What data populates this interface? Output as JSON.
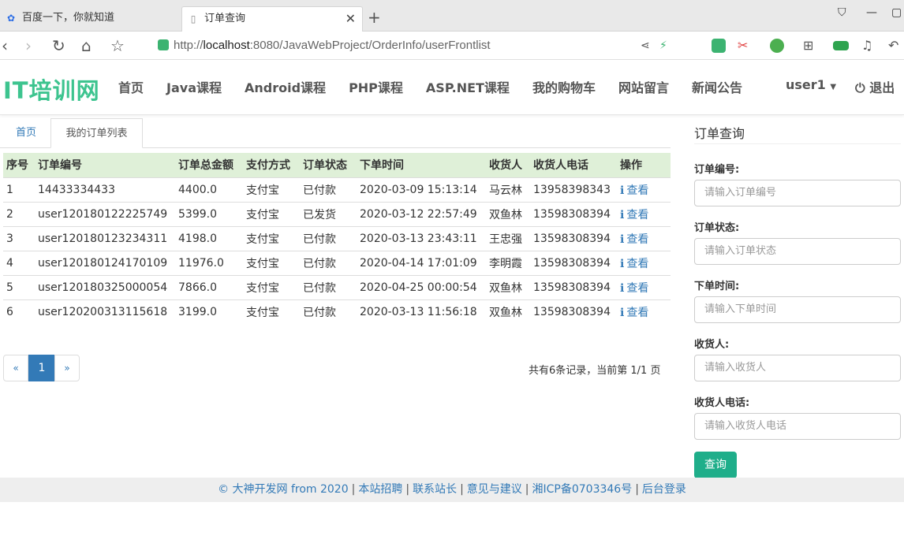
{
  "browser": {
    "tabs": [
      {
        "title": "百度一下，你就知道",
        "icon": "paw-icon"
      },
      {
        "title": "订单查询",
        "icon": "page-icon"
      }
    ],
    "url_prefix": "http://",
    "url_host": "localhost",
    "url_rest": ":8080/JavaWebProject/OrderInfo/userFrontlist"
  },
  "site": {
    "logo": "IT培训网",
    "nav": [
      "首页",
      "Java课程",
      "Android课程",
      "PHP课程",
      "ASP.NET课程",
      "我的购物车",
      "网站留言",
      "新闻公告"
    ],
    "user": "user1",
    "logout": "退出"
  },
  "page": {
    "tabs": [
      "首页",
      "我的订单列表"
    ],
    "table": {
      "headers": [
        "序号",
        "订单编号",
        "订单总金额",
        "支付方式",
        "订单状态",
        "下单时间",
        "收货人",
        "收货人电话",
        "操作"
      ],
      "rows": [
        [
          "1",
          "14433334433",
          "4400.0",
          "支付宝",
          "已付款",
          "2020-03-09 15:13:14",
          "马云林",
          "13958398343",
          "查看"
        ],
        [
          "2",
          "user120180122225749",
          "5399.0",
          "支付宝",
          "已发货",
          "2020-03-12 22:57:49",
          "双鱼林",
          "13598308394",
          "查看"
        ],
        [
          "3",
          "user120180123234311",
          "4198.0",
          "支付宝",
          "已付款",
          "2020-03-13 23:43:11",
          "王忠强",
          "13598308394",
          "查看"
        ],
        [
          "4",
          "user120180124170109",
          "11976.0",
          "支付宝",
          "已付款",
          "2020-04-14 17:01:09",
          "李明霞",
          "13598308394",
          "查看"
        ],
        [
          "5",
          "user120180325000054",
          "7866.0",
          "支付宝",
          "已付款",
          "2020-04-25 00:00:54",
          "双鱼林",
          "13598308394",
          "查看"
        ],
        [
          "6",
          "user120200313115618",
          "3199.0",
          "支付宝",
          "已付款",
          "2020-03-13 11:56:18",
          "双鱼林",
          "13598308394",
          "查看"
        ]
      ]
    },
    "pager": {
      "prev": "«",
      "current": "1",
      "next": "»"
    },
    "summary": "共有6条记录，当前第 1/1 页"
  },
  "sidebar": {
    "title": "订单查询",
    "fields": [
      {
        "label": "订单编号:",
        "placeholder": "请输入订单编号"
      },
      {
        "label": "订单状态:",
        "placeholder": "请输入订单状态"
      },
      {
        "label": "下单时间:",
        "placeholder": "请输入下单时间"
      },
      {
        "label": "收货人:",
        "placeholder": "请输入收货人"
      },
      {
        "label": "收货人电话:",
        "placeholder": "请输入收货人电话"
      }
    ],
    "button": "查询"
  },
  "footer": {
    "links": [
      "© 大神开发网 from 2020",
      "本站招聘",
      "联系站长",
      "意见与建议",
      "湘ICP备0703346号",
      "后台登录"
    ],
    "separator": "|"
  },
  "colors": {
    "logo": "#3dc48f",
    "link": "#337ab7",
    "table_header": "#dff0d8",
    "button": "#1fae8a"
  }
}
